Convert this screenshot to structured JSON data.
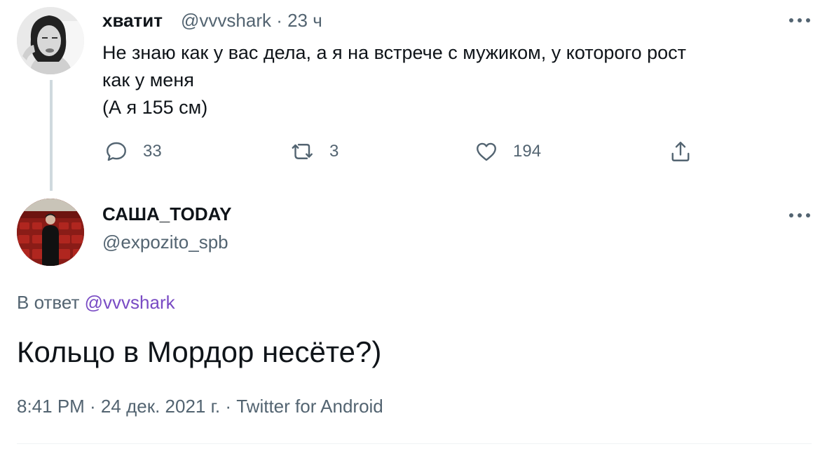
{
  "tweet1": {
    "display_name": "хватит",
    "meta": "@vvvshark · 23 ч",
    "text": "Не знаю как у вас дела, а я на встрече с мужиком, у которого рост\nкак у меня\n(А я 155 см)",
    "replies": "33",
    "retweets": "3",
    "likes": "194"
  },
  "tweet2": {
    "display_name": "САША_TODAY",
    "handle": "@expozito_spb",
    "reply_prefix": "В ответ",
    "reply_mention": "@vvvshark",
    "text": "Кольцо в Мордор несёте?)",
    "footer": "8:41 PM · 24 дек. 2021 г. · Twitter for Android"
  },
  "icons": {
    "reply": "speech-bubble-icon",
    "retweet": "retweet-icon",
    "like": "heart-icon",
    "share": "share-icon",
    "more": "more-dots-icon"
  },
  "colors": {
    "text": "#0f1419",
    "secondary": "#536471",
    "mention": "#794bc4",
    "thread_line": "#cfd9de"
  }
}
